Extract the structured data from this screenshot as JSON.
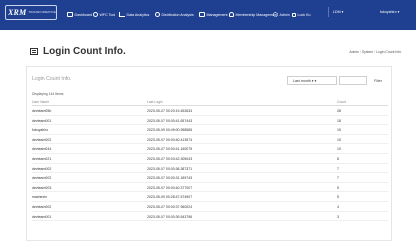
{
  "navbar": {
    "logo_mark": "XRM",
    "logo_text": "TRANSFORMATIVE",
    "items": [
      {
        "label": "Dashboard",
        "icon": "monitor-icon"
      },
      {
        "label": "WFC Tool",
        "icon": "clock-icon"
      },
      {
        "label": "Data Analytics",
        "icon": "chart-icon"
      },
      {
        "label": "Distribution Analysis",
        "icon": "gauge-icon"
      },
      {
        "label": "Management",
        "icon": "window-icon"
      },
      {
        "label": "Membership Management",
        "icon": "users-icon"
      },
      {
        "label": "Admin",
        "icon": "gear-icon"
      },
      {
        "label": "Lock Ku",
        "icon": "lock-icon"
      }
    ],
    "language": "LDM ▾",
    "user": "fukuyahiro ▾"
  },
  "page": {
    "title": "Login Count Info.",
    "breadcrumb": [
      "Admin",
      "System",
      "Login Count Info."
    ]
  },
  "panel": {
    "title": "Login Count Info.",
    "filter_select": "Last month ▾ ▾",
    "filter_input": "",
    "filter_button": "Filter",
    "display_count": "Displaying 144 Items",
    "columns": [
      "User Name",
      "Last Login",
      "Count"
    ],
    "rows": [
      [
        "devteam05b",
        "2023-05-07 00:20:19.452634",
        "28"
      ],
      [
        "devteam001",
        "2023-05-07 00:00:41.657443",
        "18"
      ],
      [
        "fukuyahiro",
        "2023-05-09 00:49:00.958585",
        "15"
      ],
      [
        "devteam002",
        "2023-05-07 00:00:40.413574",
        "15"
      ],
      [
        "devteam044",
        "2023-05-07 00:00:41.160075",
        "10"
      ],
      [
        "devteam021",
        "2023-05-07 00:03:42.305043",
        "8"
      ],
      [
        "devteam002",
        "2023-05-07 00:00:36.387371",
        "7"
      ],
      [
        "devteam002",
        "2023-05-07 00:00:31.189743",
        "7"
      ],
      [
        "devteam003",
        "2023-05-07 00:00:40.377007",
        "5"
      ],
      [
        "mashexin",
        "2023-05-09 00:28:47.574907",
        "5"
      ],
      [
        "devteam002",
        "2023-05-07 00:00:37.960024",
        "4"
      ],
      [
        "devteam001",
        "2023-05-07 00:00:39.543756",
        "3"
      ]
    ]
  },
  "colors": {
    "navbar": "#1f3f90",
    "background": "#ffffff"
  }
}
